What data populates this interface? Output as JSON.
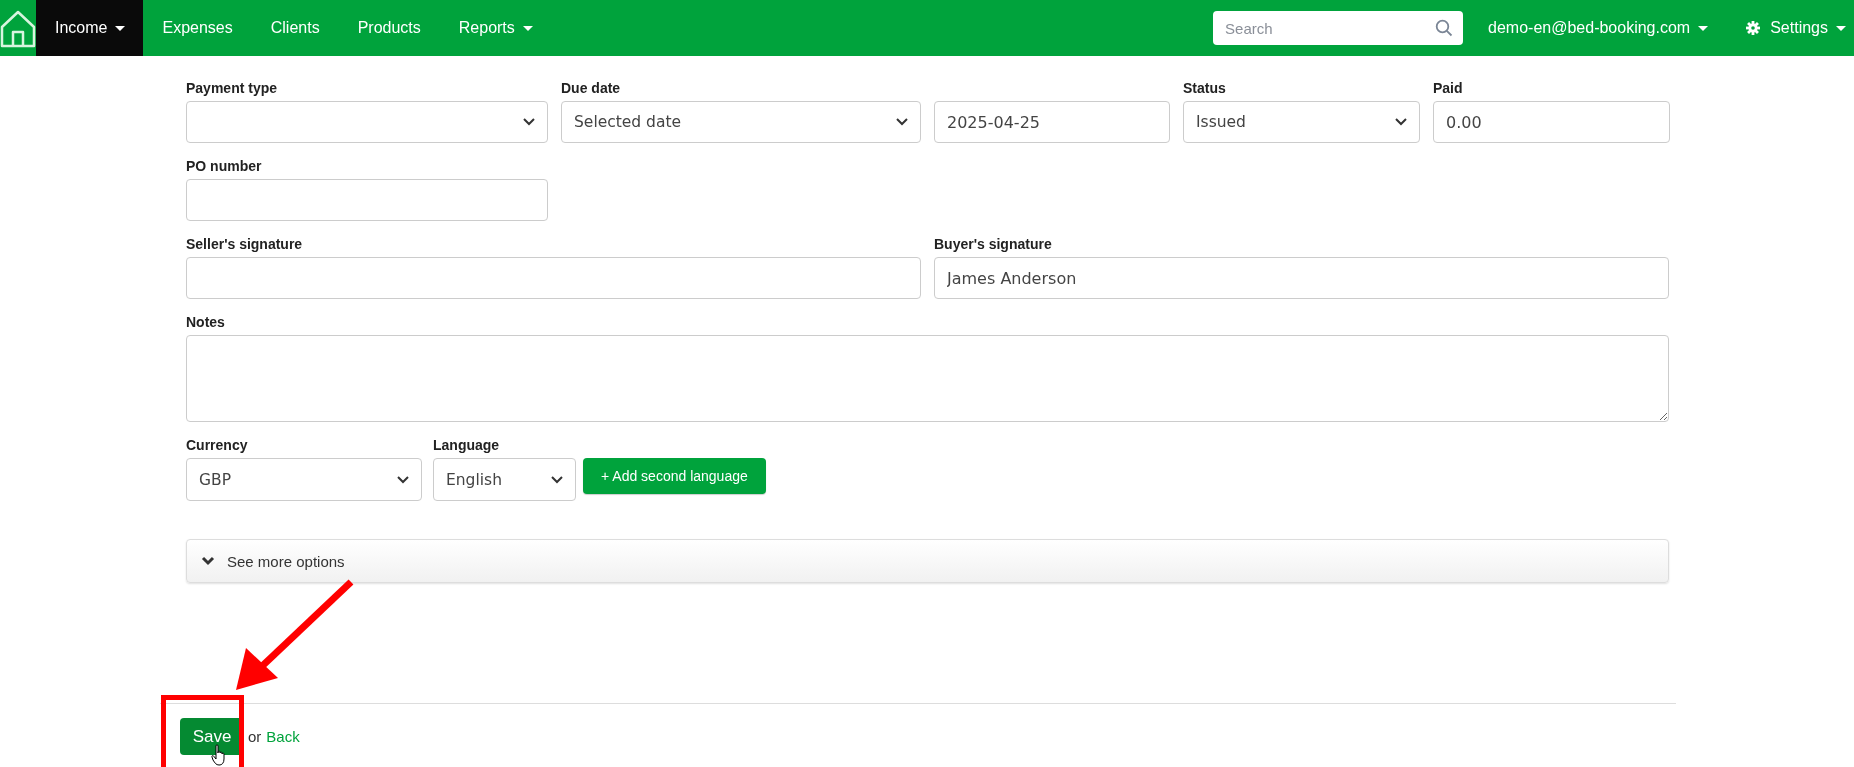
{
  "navbar": {
    "items": [
      {
        "label": "Income",
        "selected": true,
        "dropdown": true
      },
      {
        "label": "Expenses",
        "selected": false,
        "dropdown": false
      },
      {
        "label": "Clients",
        "selected": false,
        "dropdown": false
      },
      {
        "label": "Products",
        "selected": false,
        "dropdown": false
      },
      {
        "label": "Reports",
        "selected": false,
        "dropdown": true
      }
    ],
    "search": {
      "placeholder": "Search"
    },
    "account": {
      "label": "demo-en@bed-booking.com"
    },
    "settings": {
      "label": "Settings"
    }
  },
  "form": {
    "payment_type": {
      "kind": "select",
      "label": "Payment type"
    },
    "due_date": {
      "kind": "select",
      "label": "Due date",
      "value": "Selected date"
    },
    "due_date_value": {
      "kind": "input",
      "value": "2025-04-25"
    },
    "status": {
      "kind": "select",
      "label": "Status",
      "value": "Issued"
    },
    "paid": {
      "kind": "input",
      "label": "Paid",
      "value": "0.00"
    },
    "po_number": {
      "kind": "input",
      "label": "PO number"
    },
    "seller_signature": {
      "kind": "input",
      "label": "Seller's signature"
    },
    "buyer_signature": {
      "kind": "input",
      "label": "Buyer's signature",
      "value": "James Anderson"
    },
    "notes": {
      "kind": "textarea",
      "label": "Notes"
    },
    "currency": {
      "kind": "select",
      "label": "Currency",
      "value": "GBP"
    },
    "language": {
      "kind": "select",
      "label": "Language",
      "value": "English"
    },
    "add_language_button": "+ Add second language",
    "more_options": {
      "label": "See more options",
      "expanded": false
    }
  },
  "footer": {
    "save_button": "Save",
    "or_text": "or",
    "back_link": "Back"
  }
}
